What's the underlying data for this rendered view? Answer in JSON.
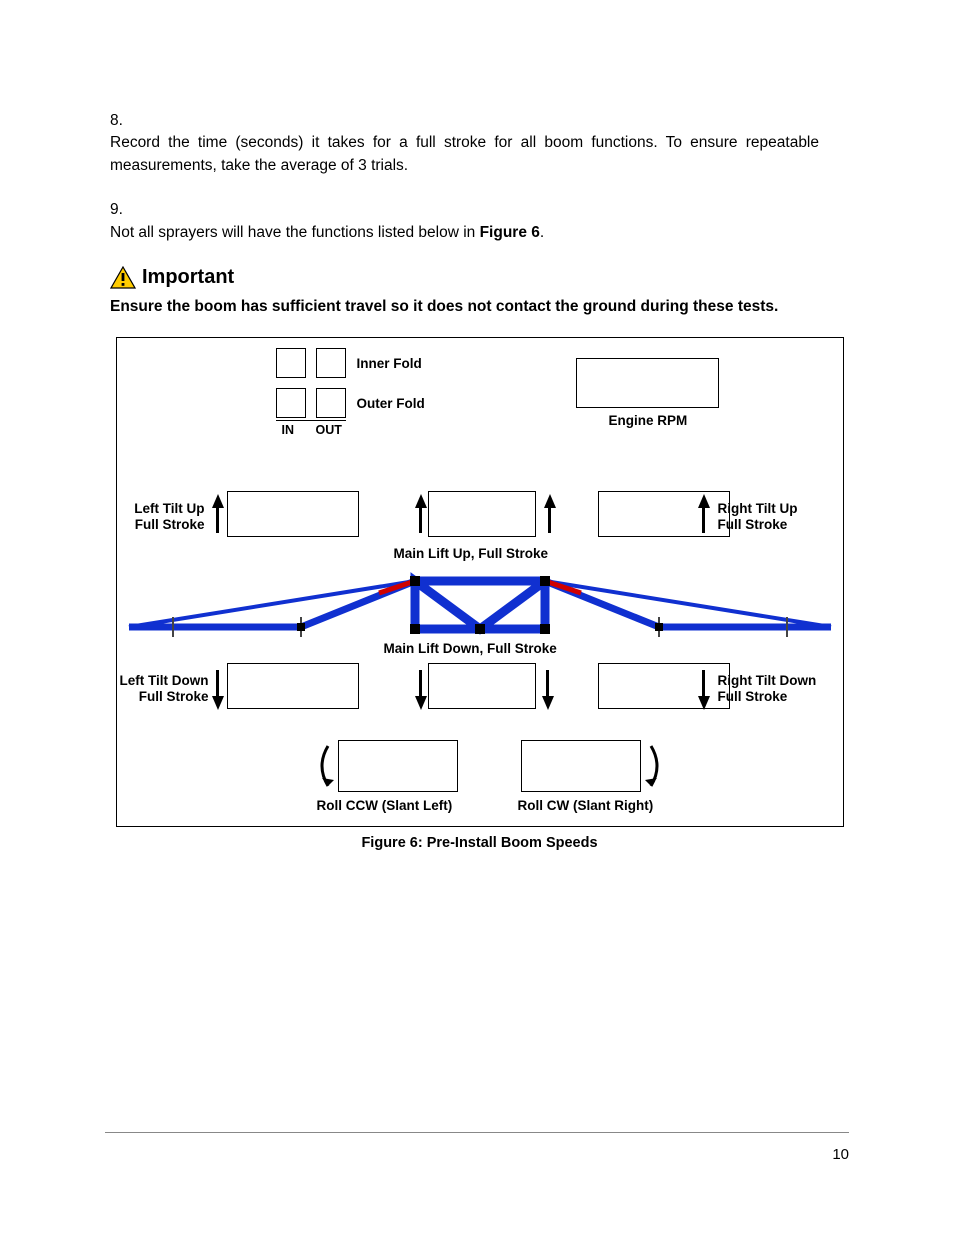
{
  "list": {
    "item8": {
      "num": "8.",
      "text_a": "Record the time (seconds) it takes for a full stroke for all boom functions.  To ensure repeatable measurements, take the average of 3 trials."
    },
    "item9": {
      "num": "9.",
      "text_a": "Not all sprayers will have the functions listed below in ",
      "text_b": "Figure 6",
      "text_c": "."
    }
  },
  "important": {
    "label": "Important",
    "text": "Ensure the boom has sufficient travel so it does not contact the ground during these tests."
  },
  "figure": {
    "caption": "Figure 6: Pre-Install Boom Speeds",
    "labels": {
      "inner_fold": "Inner Fold",
      "outer_fold": "Outer Fold",
      "in": "IN",
      "out": "OUT",
      "engine_rpm": "Engine RPM",
      "left_tilt_up_1": "Left Tilt Up",
      "left_tilt_up_2": "Full Stroke",
      "right_tilt_up_1": "Right Tilt Up",
      "right_tilt_up_2": "Full Stroke",
      "main_lift_up": "Main Lift Up, Full Stroke",
      "main_lift_down": "Main Lift Down, Full Stroke",
      "left_tilt_down_1": "Left Tilt Down",
      "left_tilt_down_2": "Full Stroke",
      "right_tilt_down_1": "Right Tilt  Down",
      "right_tilt_down_2": "Full Stroke",
      "roll_ccw": "Roll CCW (Slant Left)",
      "roll_cw": "Roll CW (Slant Right)"
    }
  },
  "page_number": "10"
}
